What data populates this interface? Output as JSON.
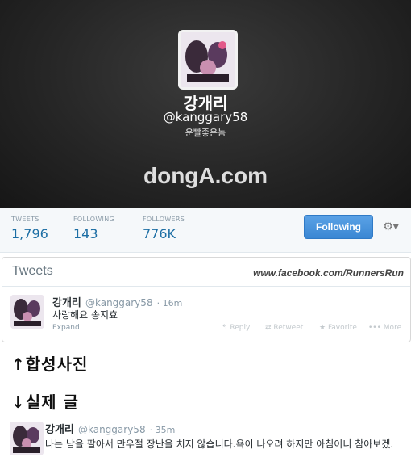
{
  "profile": {
    "name": "강개리",
    "handle": "@kanggary58",
    "bio": "운빨좋은놈",
    "watermark": "dongA.com"
  },
  "stats": [
    {
      "label": "TWEETS",
      "value": "1,796"
    },
    {
      "label": "FOLLOWING",
      "value": "143"
    },
    {
      "label": "FOLLOWERS",
      "value": "776K"
    }
  ],
  "buttons": {
    "following": "Following",
    "gear": "⚙▾"
  },
  "tweets_panel": {
    "title": "Tweets",
    "facebook_url": "www.facebook.com/RunnersRun"
  },
  "fake_tweet": {
    "name": "강개리",
    "handle": "@kanggary58",
    "time": "16m",
    "text": "사랑해요 송지효",
    "expand": "Expand",
    "actions": {
      "reply": "Reply",
      "retweet": "Retweet",
      "favorite": "Favorite",
      "more": "More"
    }
  },
  "notes": {
    "composite": "↑합성사진",
    "real": "↓실제 글"
  },
  "real_tweet": {
    "name": "강개리",
    "handle": "@kanggary58",
    "time": "35m",
    "text": "나는 남을 팔아서 만우절 장난을 치지 않습니다.욕이 나오려 하지만 아침이니 참아보겠."
  },
  "colors": {
    "header_bg": "#262626",
    "accent": "#3a87d3",
    "stat_number": "#1c6ea4"
  }
}
